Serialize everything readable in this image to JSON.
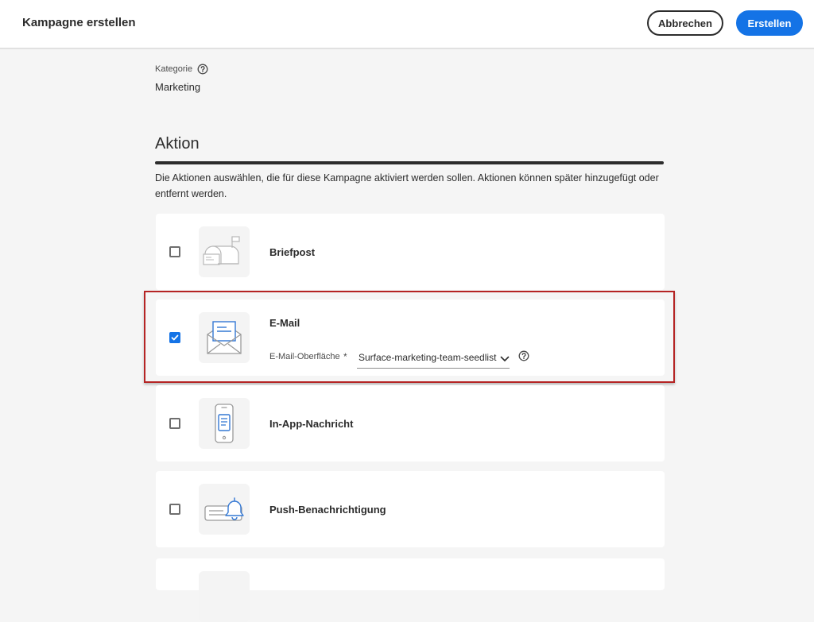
{
  "header": {
    "title": "Kampagne erstellen",
    "cancel_label": "Abbrechen",
    "create_label": "Erstellen"
  },
  "category": {
    "label": "Kategorie",
    "value": "Marketing"
  },
  "action_section": {
    "title": "Aktion",
    "description": "Die Aktionen auswählen, die für diese Kampagne aktiviert werden sollen. Aktionen können später hinzugefügt oder entfernt werden.",
    "items": [
      {
        "label": "Briefpost",
        "checked": false,
        "icon": "mailbox-icon"
      },
      {
        "label": "E-Mail",
        "checked": true,
        "icon": "email-envelope-icon",
        "field_label": "E-Mail-Oberfläche",
        "field_required": "*",
        "field_value": "Surface-marketing-team-seedlist"
      },
      {
        "label": "In-App-Nachricht",
        "checked": false,
        "icon": "mobile-message-icon"
      },
      {
        "label": "Push-Benachrichtigung",
        "checked": false,
        "icon": "push-bell-icon"
      }
    ]
  },
  "colors": {
    "accent": "#1473e6",
    "highlight": "#b52424",
    "icon_blue": "#3478d4"
  }
}
